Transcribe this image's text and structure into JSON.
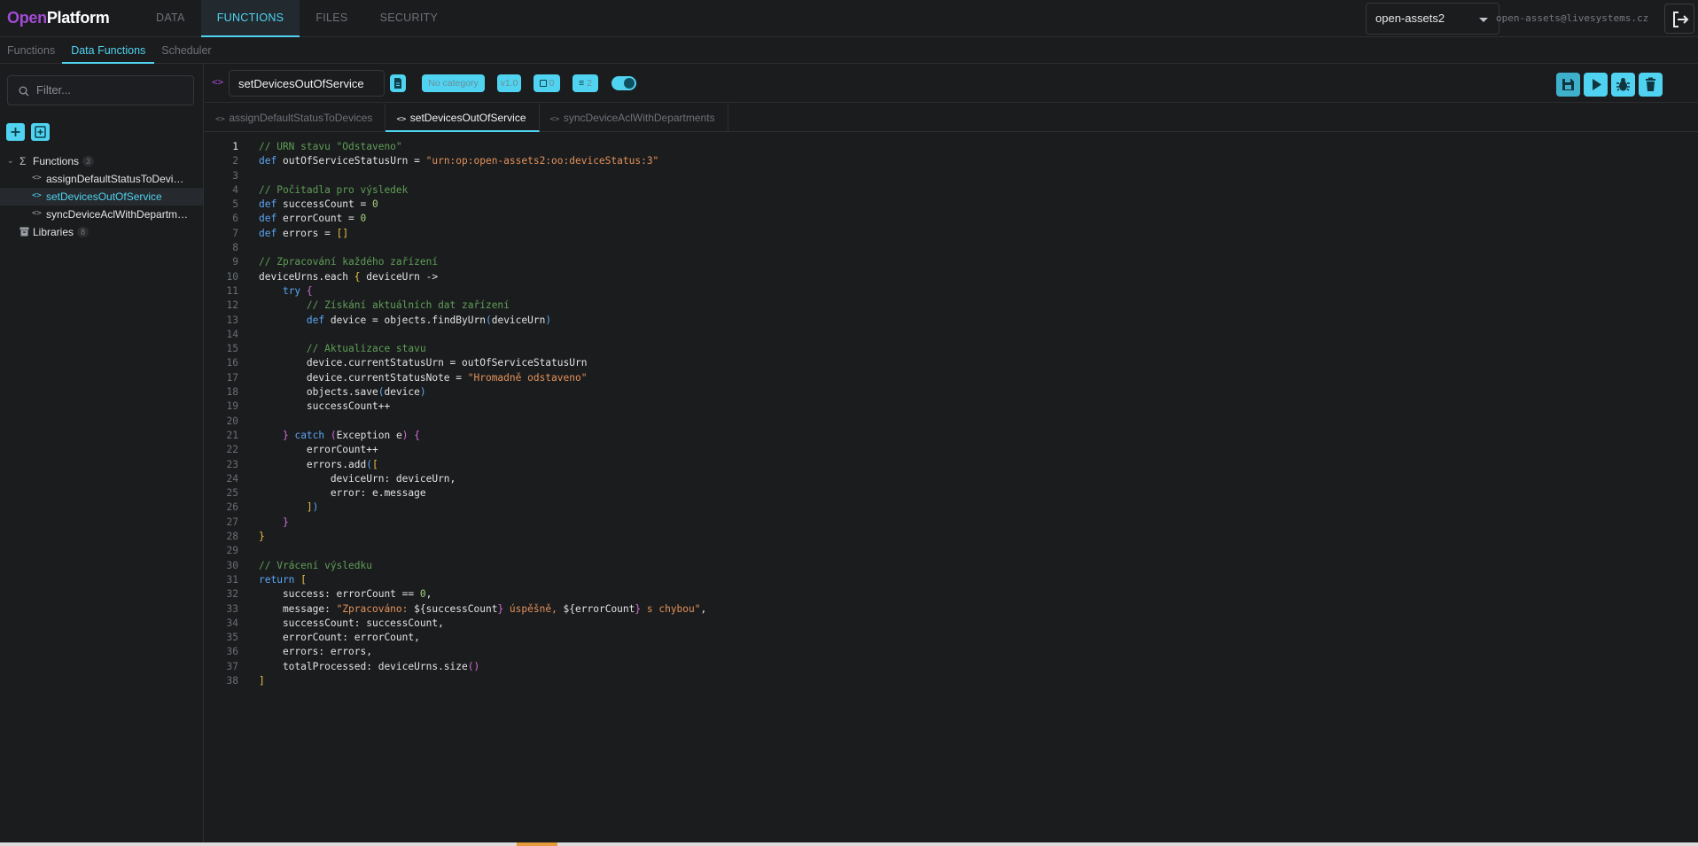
{
  "app": {
    "logo_part1": "Open",
    "logo_part2": "Platform",
    "nav": [
      "DATA",
      "FUNCTIONS",
      "FILES",
      "SECURITY"
    ],
    "active_nav": "FUNCTIONS",
    "project": "open-assets2",
    "user_email": "open-assets@livesystems.cz"
  },
  "subnav": {
    "items": [
      "Functions",
      "Data Functions",
      "Scheduler"
    ],
    "active": "Data Functions"
  },
  "sidebar": {
    "filter_placeholder": "Filter...",
    "functions_label": "Functions",
    "functions_count": "3",
    "items": [
      "assignDefaultStatusToDevi…",
      "setDevicesOutOfService",
      "syncDeviceAclWithDepartm…"
    ],
    "libraries_label": "Libraries",
    "libraries_count": "8"
  },
  "toolbar": {
    "function_name": "setDevicesOutOfService",
    "category": "No category",
    "version": "v1.0",
    "count_a": "0",
    "count_b": "2"
  },
  "tabs": [
    "assignDefaultStatusToDevices",
    "setDevicesOutOfService",
    "syncDeviceAclWithDepartments"
  ],
  "active_tab": "setDevicesOutOfService",
  "code": {
    "current_line": 1,
    "lines": [
      "// URN stavu \"Odstaveno\"",
      "def outOfServiceStatusUrn = \"urn:op:open-assets2:oo:deviceStatus:3\"",
      "",
      "// Počitadla pro výsledek",
      "def successCount = 0",
      "def errorCount = 0",
      "def errors = []",
      "",
      "// Zpracování každého zařízení",
      "deviceUrns.each { deviceUrn ->",
      "    try {",
      "        // Získání aktuálních dat zařízení",
      "        def device = objects.findByUrn(deviceUrn)",
      "",
      "        // Aktualizace stavu",
      "        device.currentStatusUrn = outOfServiceStatusUrn",
      "        device.currentStatusNote = \"Hromadně odstaveno\"",
      "        objects.save(device)",
      "        successCount++",
      "",
      "    } catch (Exception e) {",
      "        errorCount++",
      "        errors.add([",
      "            deviceUrn: deviceUrn,",
      "            error: e.message",
      "        ])",
      "    }",
      "}",
      "",
      "// Vrácení výsledku",
      "return [",
      "    success: errorCount == 0,",
      "    message: \"Zpracováno: ${successCount} úspěšně, ${errorCount} s chybou\",",
      "    successCount: successCount,",
      "    errorCount: errorCount,",
      "    errors: errors,",
      "    totalProcessed: deviceUrns.size()",
      "]"
    ]
  },
  "colors": {
    "accent": "#4fd3f0",
    "logo_purple": "#a24bd6",
    "comment": "#5f9e57",
    "keyword": "#5aa6f5",
    "string": "#e2925a",
    "number": "#a3d17e"
  }
}
